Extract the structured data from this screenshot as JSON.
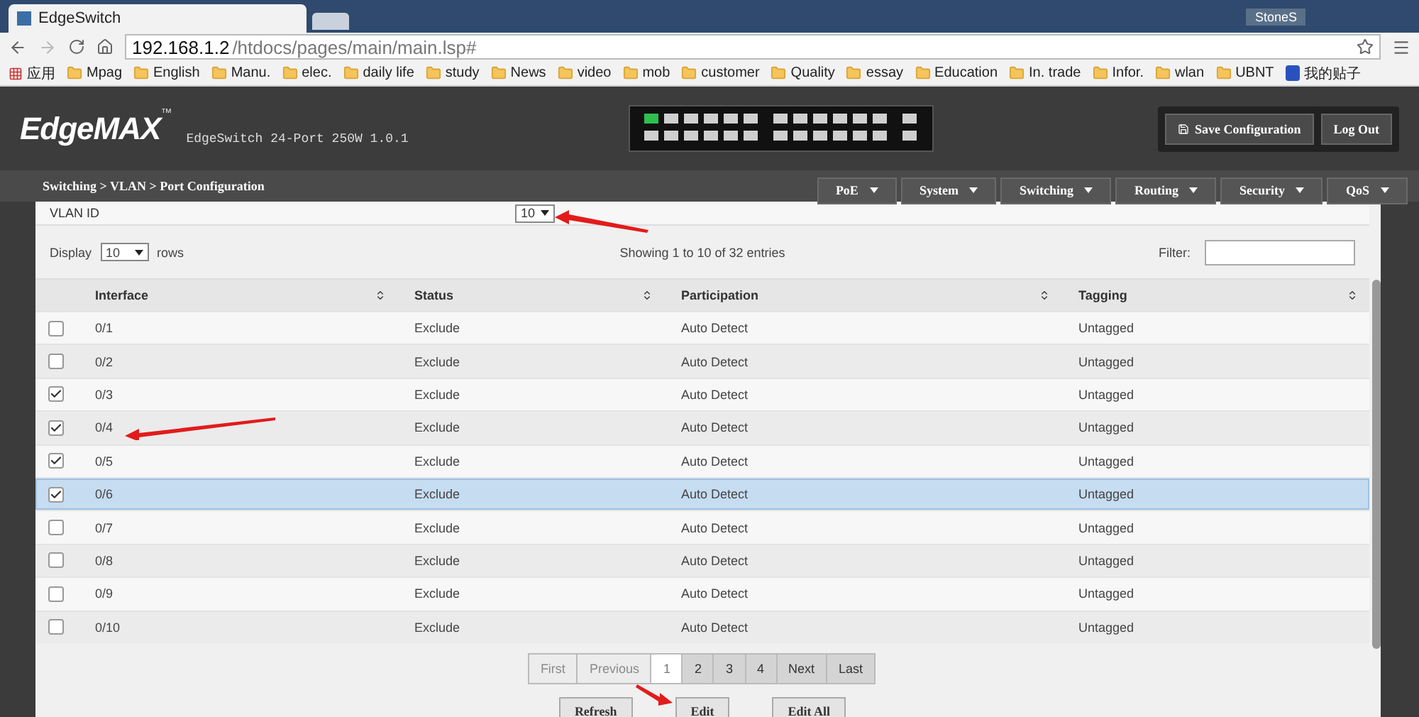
{
  "browser": {
    "tab_title": "EdgeSwitch",
    "user": "StoneS",
    "url_host": "192.168.1.2",
    "url_path": "/htdocs/pages/main/main.lsp#",
    "bookmarks": [
      {
        "kind": "apps",
        "label": "应用"
      },
      {
        "kind": "folder",
        "label": "Mpag"
      },
      {
        "kind": "folder",
        "label": "English"
      },
      {
        "kind": "folder",
        "label": "Manu."
      },
      {
        "kind": "folder",
        "label": "elec."
      },
      {
        "kind": "folder",
        "label": "daily life"
      },
      {
        "kind": "folder",
        "label": "study"
      },
      {
        "kind": "folder",
        "label": "News"
      },
      {
        "kind": "folder",
        "label": "video"
      },
      {
        "kind": "folder",
        "label": "mob"
      },
      {
        "kind": "folder",
        "label": "customer"
      },
      {
        "kind": "folder",
        "label": "Quality"
      },
      {
        "kind": "folder",
        "label": "essay"
      },
      {
        "kind": "folder",
        "label": "Education"
      },
      {
        "kind": "folder",
        "label": "In. trade"
      },
      {
        "kind": "folder",
        "label": "Infor."
      },
      {
        "kind": "folder",
        "label": "wlan"
      },
      {
        "kind": "folder",
        "label": "UBNT"
      },
      {
        "kind": "site",
        "label": "我的贴子"
      }
    ]
  },
  "header": {
    "logo": "EdgeMAX",
    "logo_mark": "™",
    "model": "EdgeSwitch 24-Port 250W 1.0.1",
    "buttons": [
      "Save Configuration",
      "Log Out"
    ]
  },
  "breadcrumb": "Switching > VLAN > Port Configuration",
  "menus": [
    "PoE",
    "System",
    "Switching",
    "Routing",
    "Security",
    "QoS"
  ],
  "vlan": {
    "label": "VLAN ID",
    "value": "10"
  },
  "display": {
    "label": "Display",
    "value": "10",
    "suffix": "rows"
  },
  "info": "Showing 1 to 10 of 32 entries",
  "filter": {
    "label": "Filter:"
  },
  "table": {
    "columns": [
      "Interface",
      "Status",
      "Participation",
      "Tagging"
    ],
    "rows": [
      {
        "checked": false,
        "selected": false,
        "cells": [
          "0/1",
          "Exclude",
          "Auto Detect",
          "Untagged"
        ]
      },
      {
        "checked": false,
        "selected": false,
        "cells": [
          "0/2",
          "Exclude",
          "Auto Detect",
          "Untagged"
        ]
      },
      {
        "checked": true,
        "selected": false,
        "cells": [
          "0/3",
          "Exclude",
          "Auto Detect",
          "Untagged"
        ]
      },
      {
        "checked": true,
        "selected": false,
        "cells": [
          "0/4",
          "Exclude",
          "Auto Detect",
          "Untagged"
        ]
      },
      {
        "checked": true,
        "selected": false,
        "cells": [
          "0/5",
          "Exclude",
          "Auto Detect",
          "Untagged"
        ]
      },
      {
        "checked": true,
        "selected": true,
        "cells": [
          "0/6",
          "Exclude",
          "Auto Detect",
          "Untagged"
        ]
      },
      {
        "checked": false,
        "selected": false,
        "cells": [
          "0/7",
          "Exclude",
          "Auto Detect",
          "Untagged"
        ]
      },
      {
        "checked": false,
        "selected": false,
        "cells": [
          "0/8",
          "Exclude",
          "Auto Detect",
          "Untagged"
        ]
      },
      {
        "checked": false,
        "selected": false,
        "cells": [
          "0/9",
          "Exclude",
          "Auto Detect",
          "Untagged"
        ]
      },
      {
        "checked": false,
        "selected": false,
        "cells": [
          "0/10",
          "Exclude",
          "Auto Detect",
          "Untagged"
        ]
      }
    ]
  },
  "pagination": [
    {
      "label": "First",
      "disabled": true,
      "selected": false
    },
    {
      "label": "Previous",
      "disabled": true,
      "selected": false
    },
    {
      "label": "1",
      "disabled": false,
      "selected": true
    },
    {
      "label": "2",
      "disabled": false,
      "selected": false
    },
    {
      "label": "3",
      "disabled": false,
      "selected": false
    },
    {
      "label": "4",
      "disabled": false,
      "selected": false
    },
    {
      "label": "Next",
      "disabled": false,
      "selected": false
    },
    {
      "label": "Last",
      "disabled": false,
      "selected": false
    }
  ],
  "actions": [
    "Refresh",
    "Edit",
    "Edit All"
  ]
}
